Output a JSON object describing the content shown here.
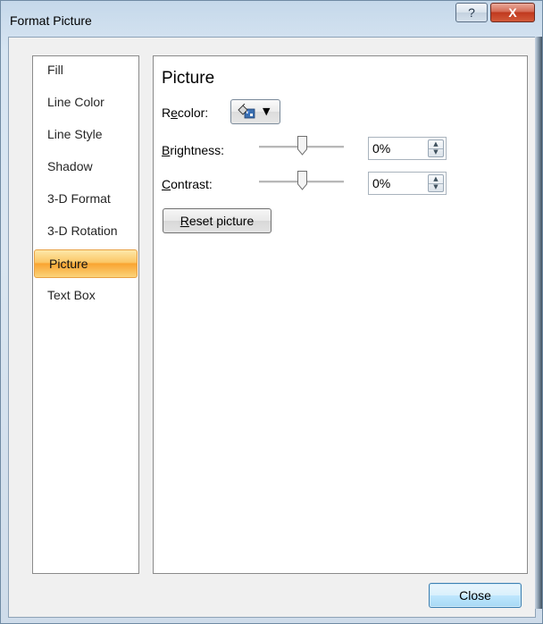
{
  "window": {
    "title": "Format Picture",
    "help_glyph": "?",
    "close_glyph": "X"
  },
  "sidebar": {
    "items": [
      {
        "label": "Fill"
      },
      {
        "label": "Line Color"
      },
      {
        "label": "Line Style"
      },
      {
        "label": "Shadow"
      },
      {
        "label": "3-D Format"
      },
      {
        "label": "3-D Rotation"
      },
      {
        "label": "Picture",
        "selected": true
      },
      {
        "label": "Text Box"
      }
    ]
  },
  "panel": {
    "title": "Picture",
    "recolor": {
      "label_pre": "R",
      "label_key": "e",
      "label_post": "color:",
      "icon": "recolor-paint-bucket-icon",
      "arrow": "▼"
    },
    "brightness": {
      "label_key": "B",
      "label_post": "rightness:",
      "value": "0%",
      "slider_fraction": 0.5
    },
    "contrast": {
      "label_key": "C",
      "label_post": "ontrast:",
      "value": "0%",
      "slider_fraction": 0.5
    },
    "reset": {
      "label_key": "R",
      "label_post": "eset picture"
    }
  },
  "footer": {
    "close_label": "Close"
  },
  "colors": {
    "selection_orange": "#f9a431",
    "close_button_blue": "#bee6fd",
    "title_close_red": "#c0391e"
  }
}
